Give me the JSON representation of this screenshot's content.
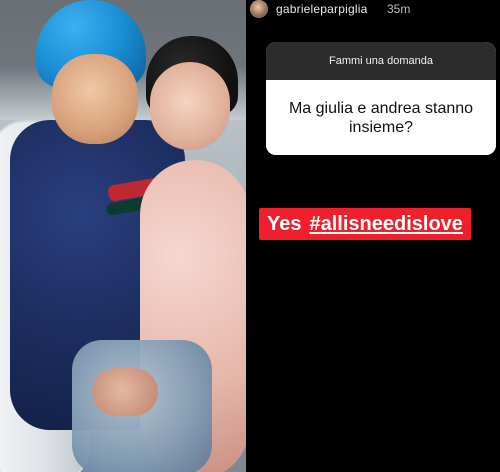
{
  "story": {
    "header": {
      "username": "gabrieleparpiglia",
      "time": "35m"
    },
    "question_card": {
      "title": "Fammi una domanda",
      "question": "Ma giulia e andrea stanno insieme?"
    },
    "answer": {
      "prefix": "Yes",
      "hashtag": "#allisneedislove"
    }
  },
  "colors": {
    "story_bg": "#000000",
    "card_header_bg": "#2c2c2c",
    "card_body_bg": "#ffffff",
    "answer_bg": "#ef1f2b",
    "hat_blue": "#1b8fd6",
    "jacket_navy": "#1d2f62",
    "stripe_red": "#c0282f",
    "fur_pink": "#e7b7aa"
  }
}
